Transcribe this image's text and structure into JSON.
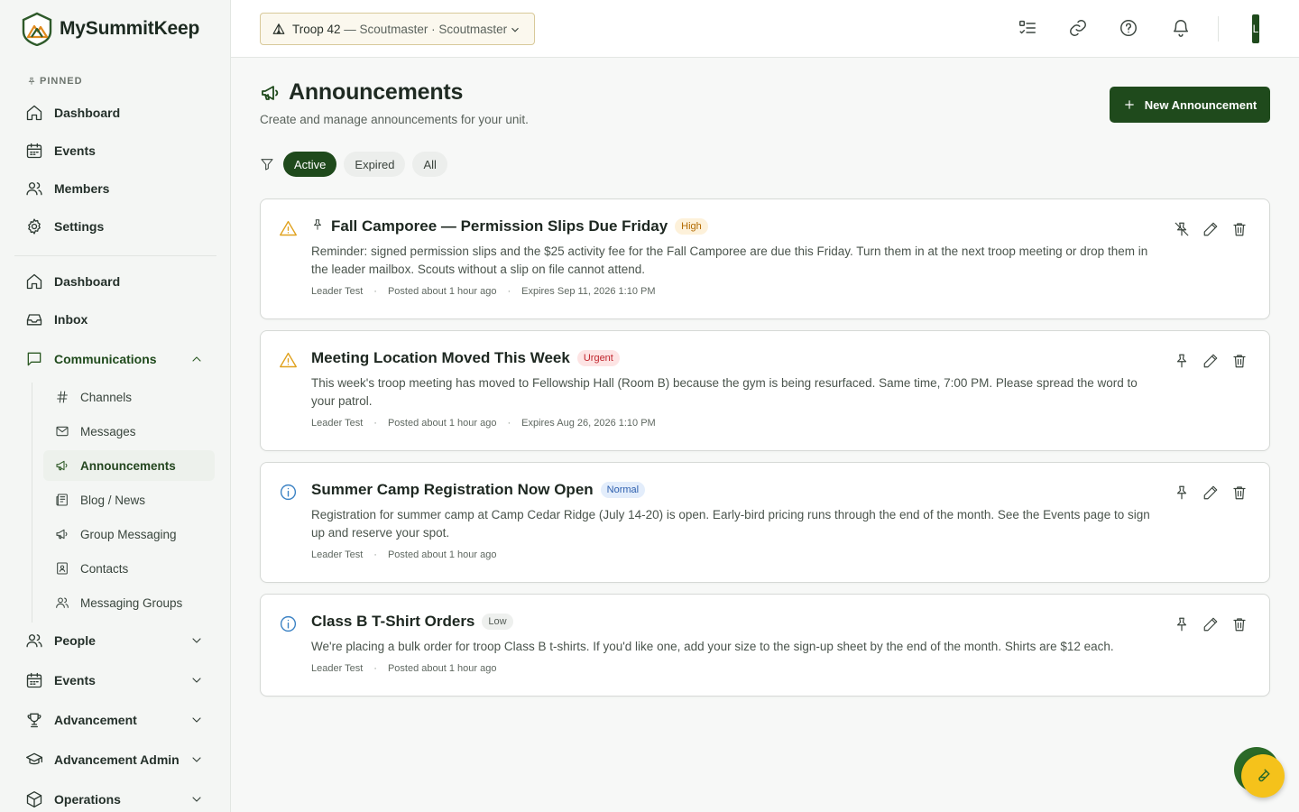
{
  "app": {
    "name": "MySummitKeep"
  },
  "sidebar": {
    "pinned_label": "PINNED",
    "pinned": [
      {
        "label": "Dashboard",
        "icon": "home-icon"
      },
      {
        "label": "Events",
        "icon": "calendar-icon"
      },
      {
        "label": "Members",
        "icon": "users-icon"
      },
      {
        "label": "Settings",
        "icon": "gear-icon"
      }
    ],
    "nav": [
      {
        "label": "Dashboard",
        "icon": "home-icon"
      },
      {
        "label": "Inbox",
        "icon": "inbox-icon"
      },
      {
        "label": "Communications",
        "icon": "message-square-icon",
        "expanded": true
      }
    ],
    "communications": [
      {
        "label": "Channels",
        "icon": "hash-icon"
      },
      {
        "label": "Messages",
        "icon": "mail-icon"
      },
      {
        "label": "Announcements",
        "icon": "megaphone-icon",
        "active": true
      },
      {
        "label": "Blog / News",
        "icon": "newspaper-icon"
      },
      {
        "label": "Group Messaging",
        "icon": "megaphone-icon"
      },
      {
        "label": "Contacts",
        "icon": "contact-book-icon"
      },
      {
        "label": "Messaging Groups",
        "icon": "users-icon"
      }
    ],
    "sections": [
      {
        "label": "People",
        "icon": "users-icon"
      },
      {
        "label": "Events",
        "icon": "calendar-icon"
      },
      {
        "label": "Advancement",
        "icon": "trophy-icon"
      },
      {
        "label": "Advancement Admin",
        "icon": "graduation-cap-icon"
      },
      {
        "label": "Operations",
        "icon": "box-icon"
      }
    ]
  },
  "topbar": {
    "unit_name": "Troop 42",
    "unit_role": " — Scoutmaster · Scoutmaster",
    "avatar_initial": "L"
  },
  "main": {
    "title": "Announcements",
    "subtitle": "Create and manage announcements for your unit.",
    "new_button": "New Announcement",
    "filters": [
      "Active",
      "Expired",
      "All"
    ],
    "active_filter": "Active"
  },
  "announcements": [
    {
      "title": "Fall Camporee — Permission Slips Due Friday",
      "priority": "High",
      "pinned": true,
      "icon": "warning-triangle-icon",
      "body": "Reminder: signed permission slips and the $25 activity fee for the Fall Camporee are due this Friday. Turn them in at the next troop meeting or drop them in the leader mailbox. Scouts without a slip on file cannot attend.",
      "author": "Leader Test",
      "posted": "Posted about 1 hour ago",
      "expires": "Expires Sep 11, 2026 1:10 PM"
    },
    {
      "title": "Meeting Location Moved This Week",
      "priority": "Urgent",
      "pinned": false,
      "icon": "warning-triangle-icon",
      "body": "This week's troop meeting has moved to Fellowship Hall (Room B) because the gym is being resurfaced. Same time, 7:00 PM. Please spread the word to your patrol.",
      "author": "Leader Test",
      "posted": "Posted about 1 hour ago",
      "expires": "Expires Aug 26, 2026 1:10 PM"
    },
    {
      "title": "Summer Camp Registration Now Open",
      "priority": "Normal",
      "pinned": false,
      "icon": "info-circle-icon",
      "body": "Registration for summer camp at Camp Cedar Ridge (July 14-20) is open. Early-bird pricing runs through the end of the month. See the Events page to sign up and reserve your spot.",
      "author": "Leader Test",
      "posted": "Posted about 1 hour ago",
      "expires": ""
    },
    {
      "title": "Class B T-Shirt Orders",
      "priority": "Low",
      "pinned": false,
      "icon": "info-circle-icon",
      "body": "We're placing a bulk order for troop Class B t-shirts. If you'd like one, add your size to the sign-up sheet by the end of the month. Shirts are $12 each.",
      "author": "Leader Test",
      "posted": "Posted about 1 hour ago",
      "expires": ""
    }
  ],
  "colors": {
    "brand": "#1f4a1c",
    "high_bg": "#fdf1da",
    "high_fg": "#b26a00",
    "urgent_bg": "#fde4e4",
    "urgent_fg": "#c0262d",
    "normal_bg": "#e3edfb",
    "normal_fg": "#2d5fae",
    "low_bg": "#eef0ee",
    "low_fg": "#555d57",
    "warning": "#e0a21f",
    "info": "#3b82c4",
    "fab": "#f5c21b"
  }
}
